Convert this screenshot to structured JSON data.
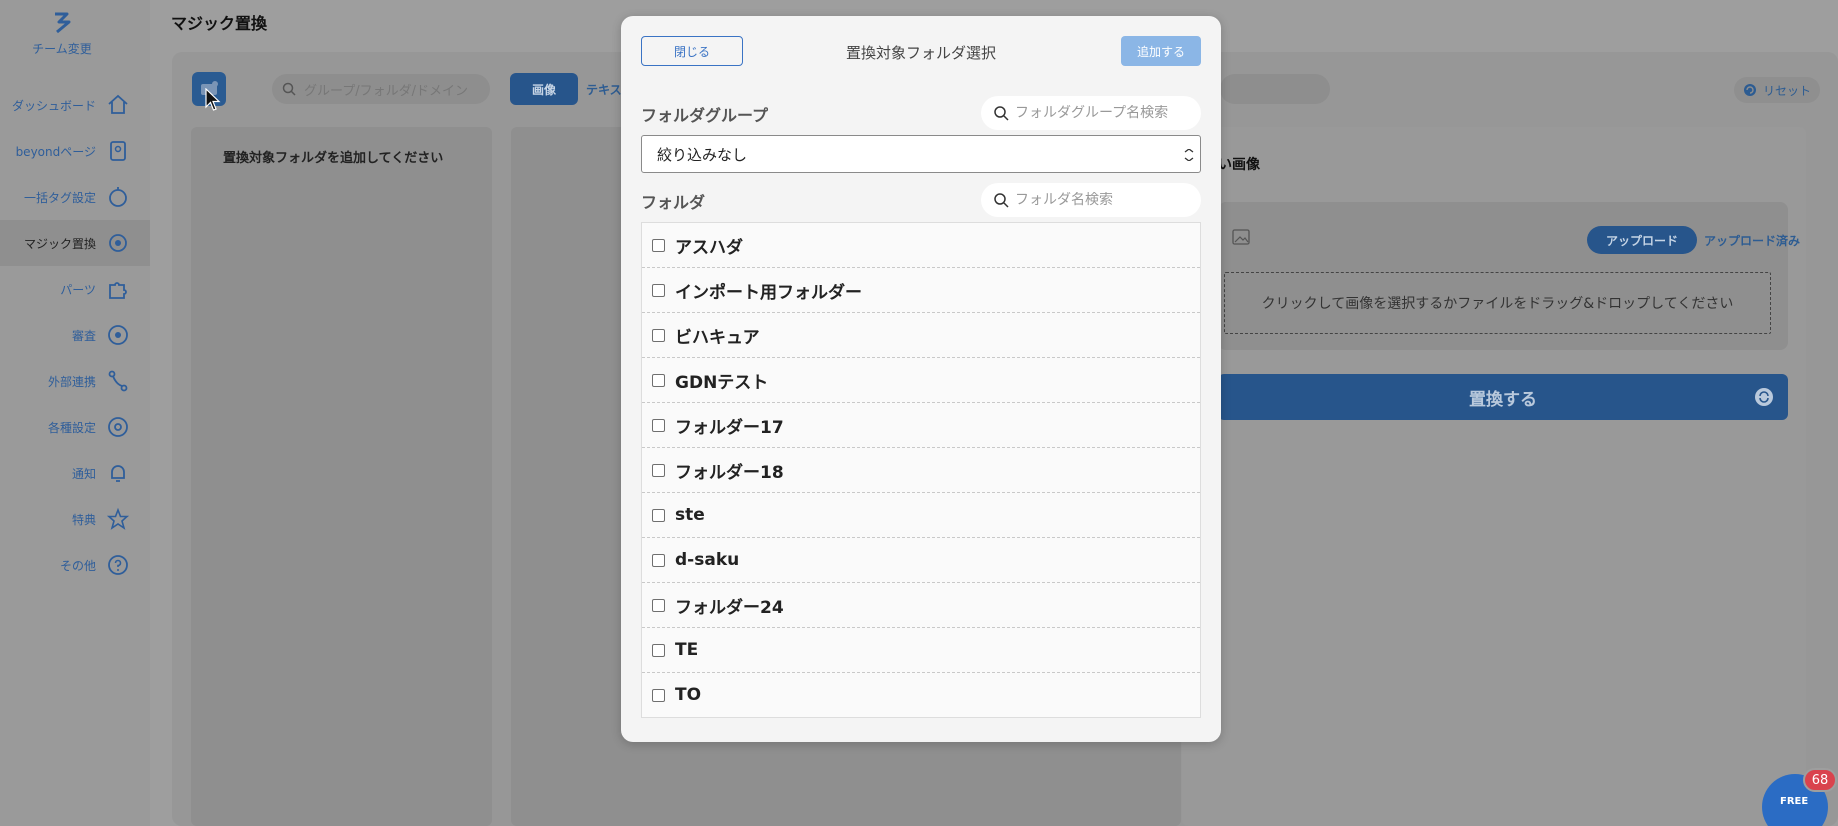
{
  "sidebar": {
    "team_change": "チーム変更",
    "items": [
      {
        "label": "ダッシュボード",
        "icon": "home-icon"
      },
      {
        "label": "beyondページ",
        "icon": "page-icon"
      },
      {
        "label": "一括タグ設定",
        "icon": "tag-icon"
      },
      {
        "label": "マジック置換",
        "icon": "magic-replace-icon",
        "active": true
      },
      {
        "label": "パーツ",
        "icon": "puzzle-icon"
      },
      {
        "label": "審査",
        "icon": "eye-icon"
      },
      {
        "label": "外部連携",
        "icon": "link-icon"
      },
      {
        "label": "各種設定",
        "icon": "gear-icon"
      },
      {
        "label": "通知",
        "icon": "bell-icon"
      },
      {
        "label": "特典",
        "icon": "star-icon"
      },
      {
        "label": "その他",
        "icon": "help-icon"
      }
    ]
  },
  "app": {
    "title": "マジック置換",
    "search_placeholder": "グループ/フォルダ/ドメイン",
    "tab_image": "画像",
    "tab_text": "テキス",
    "reset": "リセット",
    "left_hint": "置換対象フォルダを追加してください",
    "right_title": "い画像",
    "upload_tab": "アップロード",
    "uploaded_tab": "アップロード済み",
    "dropzone": "クリックして画像を選択するかファイルをドラッグ&ドロップしてください",
    "replace_button": "置換する"
  },
  "chat": {
    "label": "FREE",
    "badge": "68"
  },
  "modal": {
    "close": "閉じる",
    "title": "置換対象フォルダ選択",
    "add": "追加する",
    "group_label": "フォルダグループ",
    "group_search_placeholder": "フォルダグループ名検索",
    "group_select_value": "絞り込みなし",
    "folder_label": "フォルダ",
    "folder_search_placeholder": "フォルダ名検索",
    "folders": [
      "アスハダ",
      "インポート用フォルダー",
      "ビハキュア",
      "GDNテスト",
      "フォルダー17",
      "フォルダー18",
      "ste",
      "d-saku",
      "フォルダー24",
      "TE",
      "TO"
    ]
  },
  "colors": {
    "primary": "#3a73c4",
    "add_disabled": "#8bb6e6",
    "badge": "#d9434d"
  }
}
